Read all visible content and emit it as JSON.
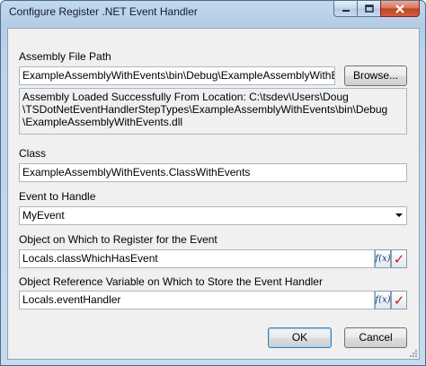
{
  "window": {
    "title": "Configure Register .NET Event Handler",
    "controls": {
      "minimize": "minimize-icon",
      "maximize": "maximize-icon",
      "close": "close-icon"
    }
  },
  "assembly": {
    "label": "Assembly File Path",
    "value": "ExampleAssemblyWithEvents\\bin\\Debug\\ExampleAssemblyWithEvents.d",
    "browse_label": "Browse...",
    "status": "Assembly Loaded Successfully From Location: C:\\tsdev\\Users\\Doug\n\\TSDotNetEventHandlerStepTypes\\ExampleAssemblyWithEvents\\bin\\Debug\n\\ExampleAssemblyWithEvents.dll"
  },
  "class": {
    "label": "Class",
    "value": "ExampleAssemblyWithEvents.ClassWithEvents"
  },
  "event": {
    "label": "Event to Handle",
    "value": "MyEvent"
  },
  "register_object": {
    "label": "Object on Which to Register for the Event",
    "value": "Locals.classWhichHasEvent",
    "expr_button": "f(x)",
    "check_button": "✓"
  },
  "handler_variable": {
    "label": "Object Reference Variable on Which to Store the Event Handler",
    "value": "Locals.eventHandler",
    "expr_button": "f(x)",
    "check_button": "✓"
  },
  "buttons": {
    "ok": "OK",
    "cancel": "Cancel"
  },
  "colors": {
    "title_bar": "#b4cce6",
    "close_button": "#c1401f",
    "check_mark": "#d01818"
  }
}
